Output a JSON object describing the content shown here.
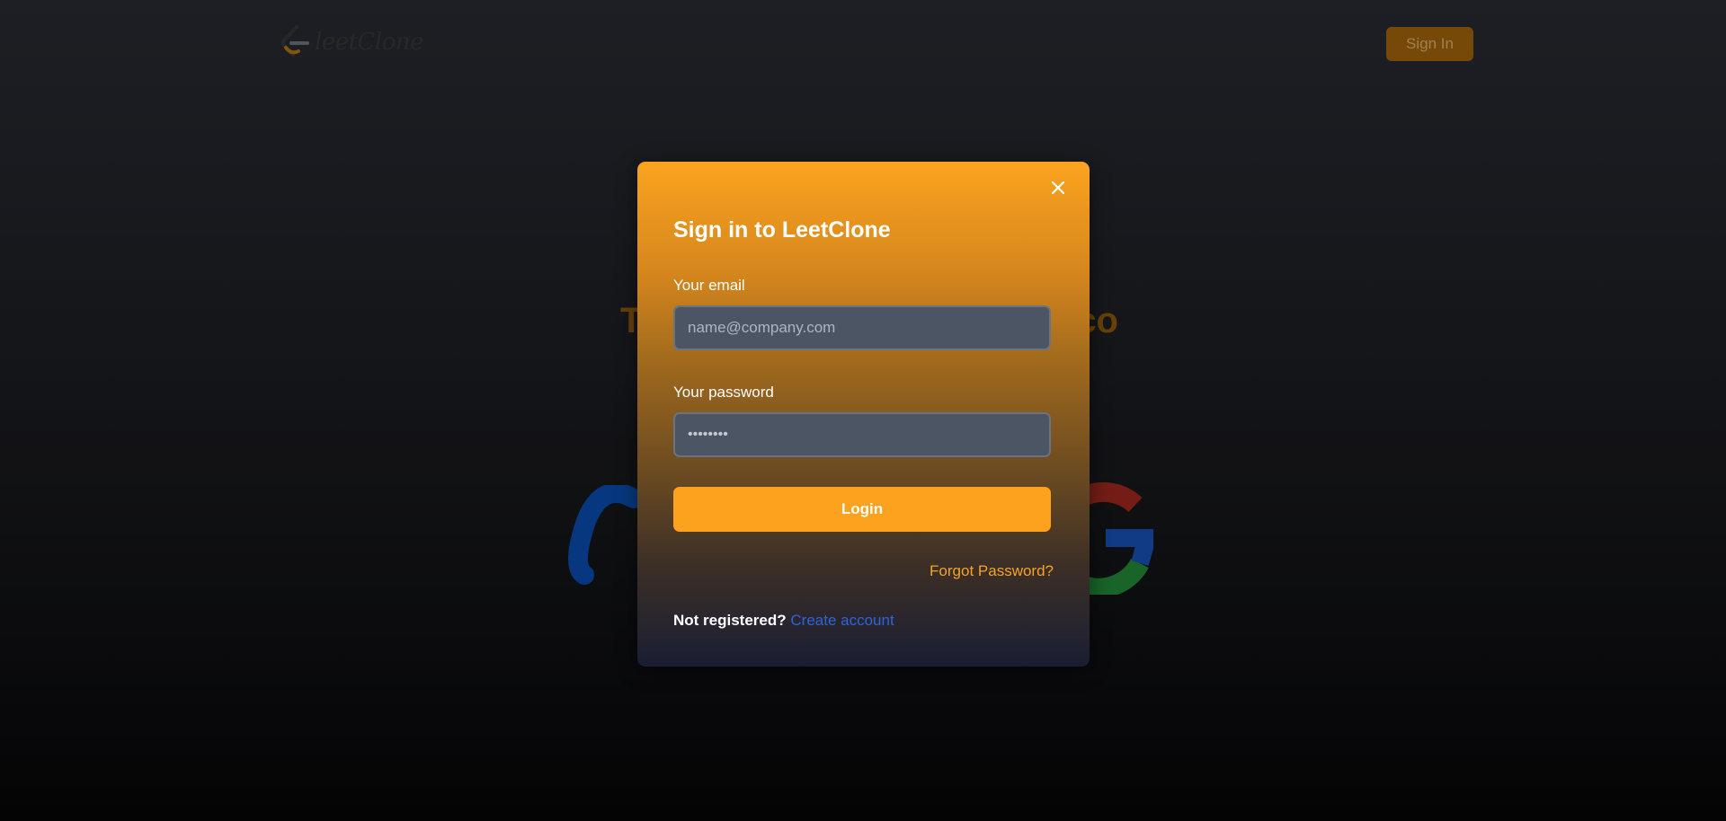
{
  "app": {
    "logo_text": "leetClone"
  },
  "navbar": {
    "signin_label": "Sign In"
  },
  "hero": {
    "heading_fragment_left": "T",
    "heading_fragment_right": "co"
  },
  "modal": {
    "title": "Sign in to LeetClone",
    "email_label": "Your email",
    "email_placeholder": "name@company.com",
    "password_label": "Your password",
    "password_value": "••••••••",
    "login_label": "Login",
    "forgot_label": "Forgot Password?",
    "not_registered_label": "Not registered?",
    "create_account_label": "Create account"
  },
  "icons": {
    "close": "close-icon",
    "logo": "leetcode-logo-icon",
    "meta": "meta-logo-icon",
    "google": "google-logo-icon"
  },
  "colors": {
    "brand_orange": "#fca21f",
    "link_blue": "#2f63d8",
    "input_bg": "#4b5563"
  }
}
